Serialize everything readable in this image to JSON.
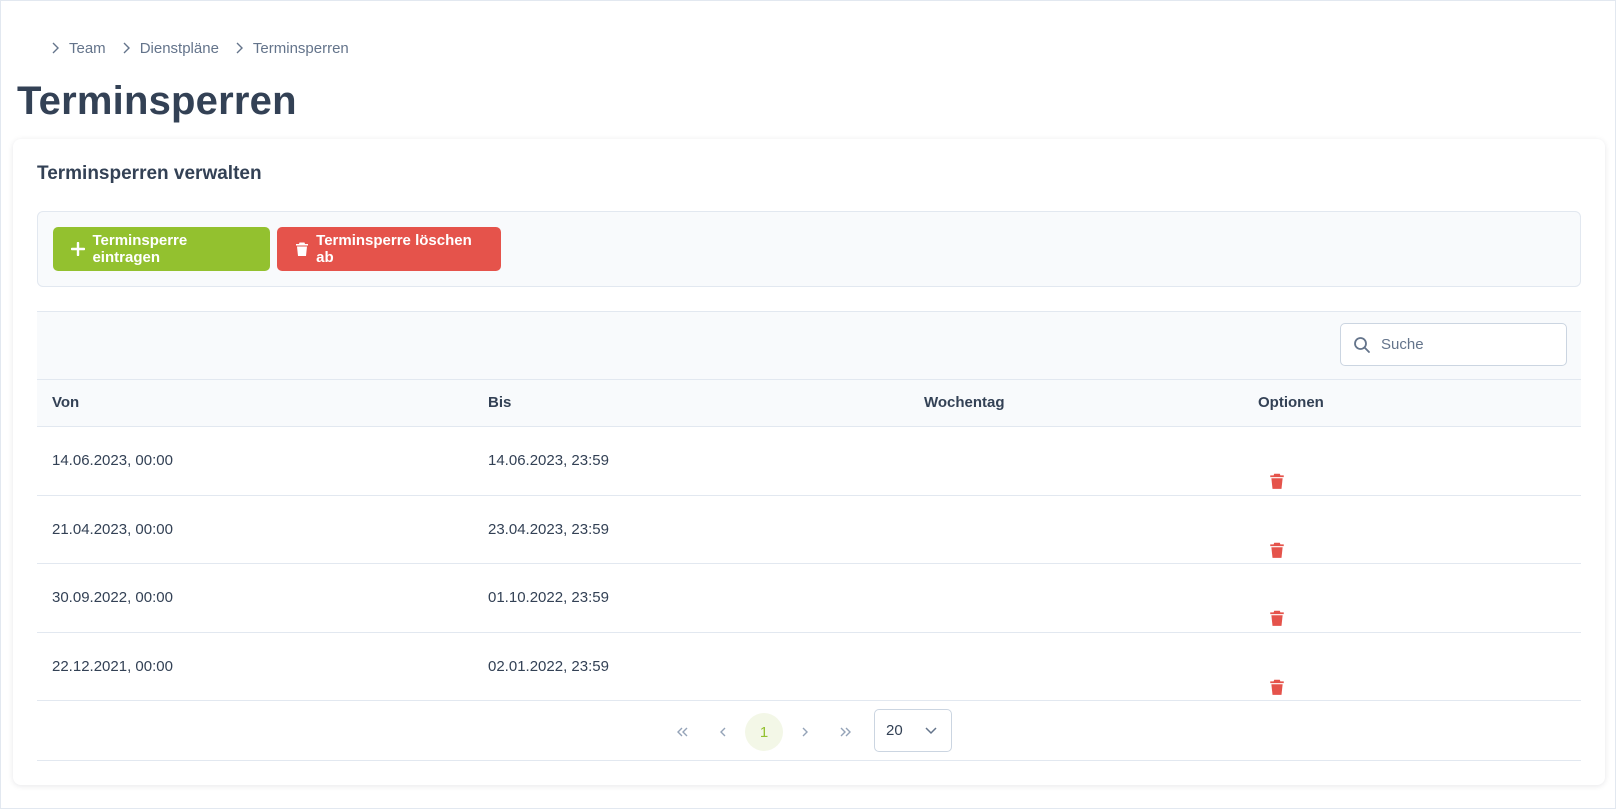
{
  "breadcrumb": [
    "Team",
    "Dienstpläne",
    "Terminsperren"
  ],
  "page_title": "Terminsperren",
  "card": {
    "title": "Terminsperren verwalten",
    "add_button": "Terminsperre eintragen",
    "delete_button": "Terminsperre löschen ab"
  },
  "search": {
    "placeholder": "Suche",
    "icon": "search-icon"
  },
  "table": {
    "columns": [
      "Von",
      "Bis",
      "Wochentag",
      "Optionen"
    ],
    "rows": [
      {
        "von": "14.06.2023, 00:00",
        "bis": "14.06.2023, 23:59",
        "wochentag": ""
      },
      {
        "von": "21.04.2023, 00:00",
        "bis": "23.04.2023, 23:59",
        "wochentag": ""
      },
      {
        "von": "30.09.2022, 00:00",
        "bis": "01.10.2022, 23:59",
        "wochentag": ""
      },
      {
        "von": "22.12.2021, 00:00",
        "bis": "02.01.2022, 23:59",
        "wochentag": ""
      }
    ]
  },
  "pagination": {
    "current_page": "1",
    "per_page": "20"
  },
  "colors": {
    "accent_green": "#93c12f",
    "danger_red": "#e5534b",
    "text": "#334155"
  }
}
